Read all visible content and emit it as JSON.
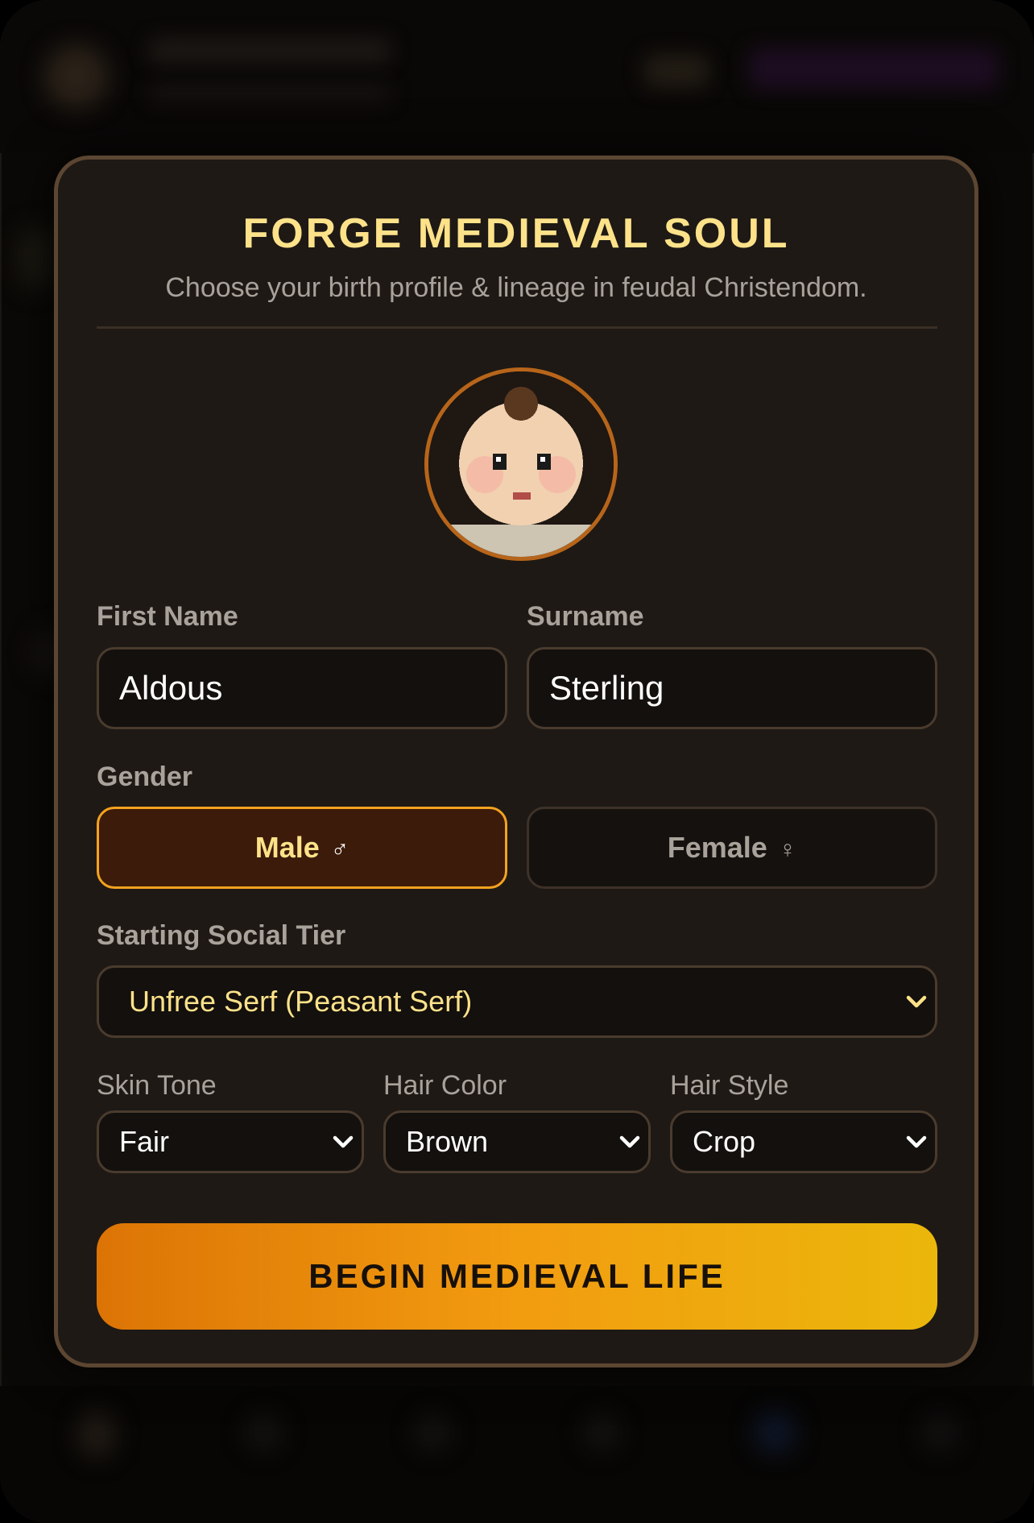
{
  "modal": {
    "title": "FORGE MEDIEVAL SOUL",
    "subtitle": "Choose your birth profile & lineage in feudal Christendom."
  },
  "form": {
    "first_name_label": "First Name",
    "first_name_value": "Aldous",
    "surname_label": "Surname",
    "surname_value": "Sterling",
    "gender_label": "Gender",
    "gender_options": [
      {
        "label": "Male",
        "symbol": "♂",
        "selected": true
      },
      {
        "label": "Female",
        "symbol": "♀",
        "selected": false
      }
    ],
    "social_tier_label": "Starting Social Tier",
    "social_tier_value": "Unfree Serf (Peasant Serf)",
    "skin_tone_label": "Skin Tone",
    "skin_tone_value": "Fair",
    "hair_color_label": "Hair Color",
    "hair_color_value": "Brown",
    "hair_style_label": "Hair Style",
    "hair_style_value": "Crop"
  },
  "cta": {
    "label": "BEGIN MEDIEVAL LIFE"
  },
  "colors": {
    "accent_gold": "#fde28a",
    "accent_orange": "#f4a21f",
    "modal_bg": "#1e1915",
    "modal_border": "#5c4632",
    "cta_gradient_start": "#dc7405",
    "cta_gradient_end": "#ebb70b"
  },
  "icons": {
    "avatar": "pixel-peasant-portrait",
    "select_chevron": "chevron-down-icon"
  }
}
